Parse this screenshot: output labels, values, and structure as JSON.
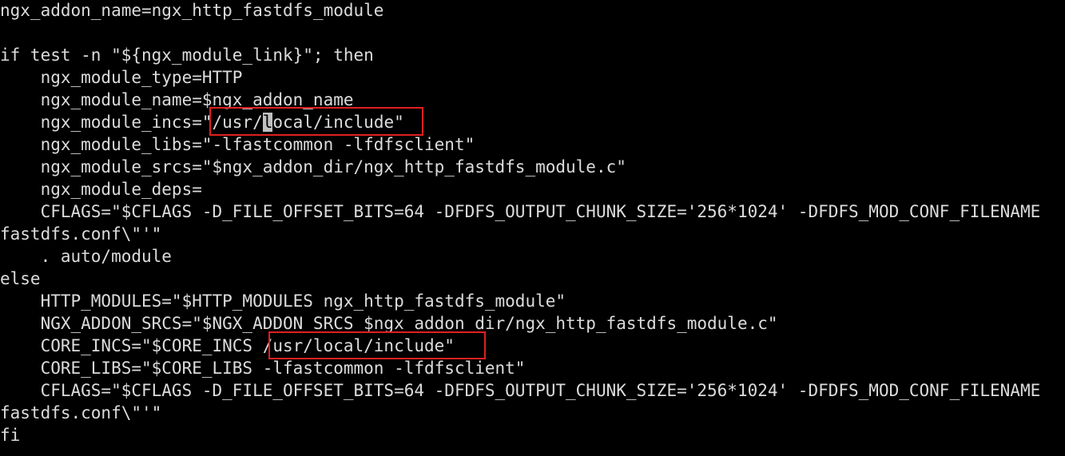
{
  "terminal": {
    "lines": [
      "ngx_addon_name=ngx_http_fastdfs_module",
      "",
      "if test -n \"${ngx_module_link}\"; then",
      "    ngx_module_type=HTTP",
      "    ngx_module_name=$ngx_addon_name",
      "    ngx_module_incs=\"/usr/local/include\"",
      "    ngx_module_libs=\"-lfastcommon -lfdfsclient\"",
      "    ngx_module_srcs=\"$ngx_addon_dir/ngx_http_fastdfs_module.c\"",
      "    ngx_module_deps=",
      "    CFLAGS=\"$CFLAGS -D_FILE_OFFSET_BITS=64 -DFDFS_OUTPUT_CHUNK_SIZE='256*1024' -DFDFS_MOD_CONF_FILENAME",
      "fastdfs.conf\\\"'\"",
      "    . auto/module",
      "else",
      "    HTTP_MODULES=\"$HTTP_MODULES ngx_http_fastdfs_module\"",
      "    NGX_ADDON_SRCS=\"$NGX_ADDON_SRCS $ngx_addon_dir/ngx_http_fastdfs_module.c\"",
      "    CORE_INCS=\"$CORE_INCS /usr/local/include\"",
      "    CORE_LIBS=\"$CORE_LIBS -lfastcommon -lfdfsclient\"",
      "    CFLAGS=\"$CFLAGS -D_FILE_OFFSET_BITS=64 -DFDFS_OUTPUT_CHUNK_SIZE='256*1024' -DFDFS_MOD_CONF_FILENAME",
      "fastdfs.conf\\\"'\"",
      "fi"
    ],
    "cursor_line": {
      "before": "    ngx_module_incs=\"/usr/",
      "cursor_char": "l",
      "after": "ocal/include\""
    }
  },
  "colors": {
    "background": "#000000",
    "text": "#dcdcdc",
    "cursor": "#c0c0c0",
    "highlight_box": "#e02020"
  }
}
